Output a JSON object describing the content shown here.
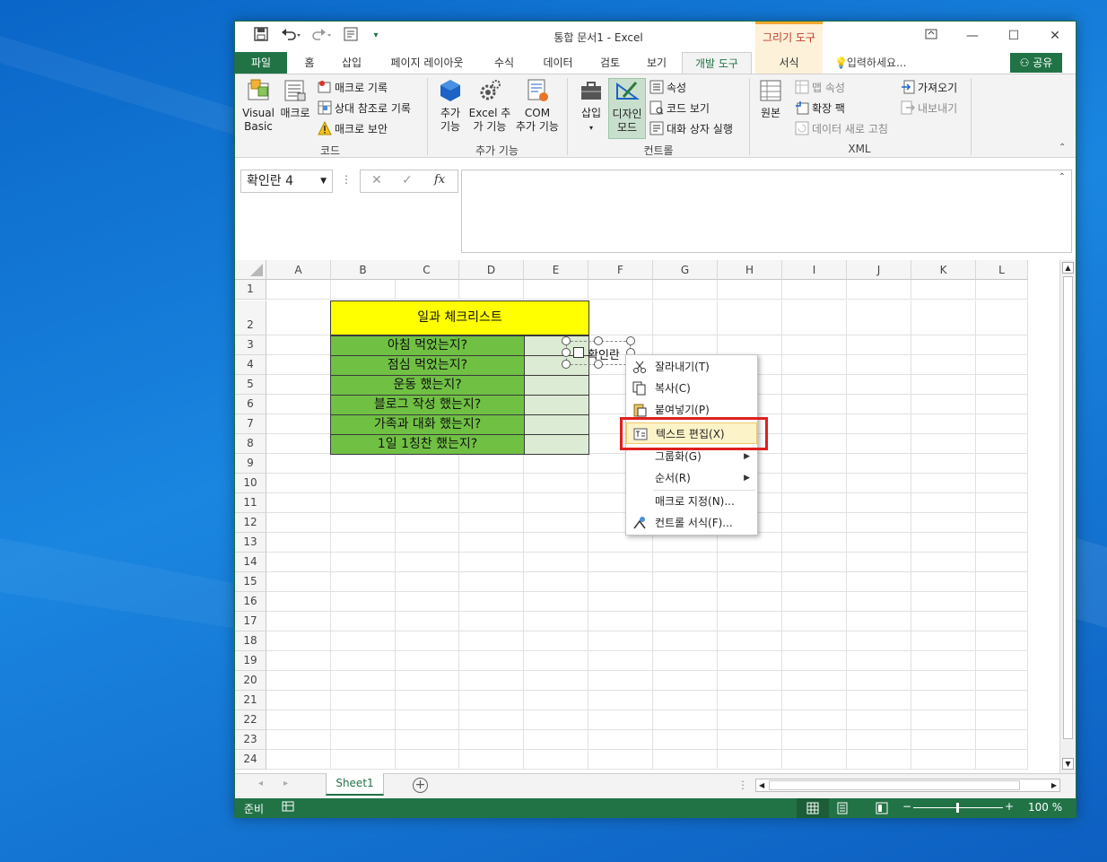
{
  "title": "통합 문서1 - Excel",
  "contextual_tab": "그리기 도구",
  "tabs": [
    "파일",
    "홈",
    "삽입",
    "페이지 레이아웃",
    "수식",
    "데이터",
    "검토",
    "보기",
    "개발 도구",
    "서식"
  ],
  "tell_me": "입력하세요...",
  "share": "공유",
  "ribbon": {
    "code": {
      "label": "코드",
      "visual_basic": "Visual Basic",
      "macro": "매크로",
      "record_macro": "매크로 기록",
      "relative_ref": "상대 참조로 기록",
      "macro_security": "매크로 보안"
    },
    "addins": {
      "label": "추가 기능",
      "addins_1": "추가",
      "addins_2": "기능",
      "excel_addins_1": "Excel 추",
      "excel_addins_2": "가 기능",
      "com_1": "COM",
      "com_2": "추가 기능"
    },
    "controls": {
      "label": "컨트롤",
      "insert": "삽입",
      "design_mode_1": "디자인",
      "design_mode_2": "모드",
      "properties": "속성",
      "view_code": "코드 보기",
      "run_dialog": "대화 상자 실행"
    },
    "xml": {
      "label": "XML",
      "source": "원본",
      "map_properties": "맵 속성",
      "expansion_packs": "확장 팩",
      "refresh_data": "데이터 새로 고침",
      "import": "가져오기",
      "export": "내보내기"
    }
  },
  "namebox": "확인란 4",
  "fx": "fx",
  "columns": [
    "A",
    "B",
    "C",
    "D",
    "E",
    "F",
    "G",
    "H",
    "I",
    "J",
    "K",
    "L"
  ],
  "rows": [
    "1",
    "2",
    "3",
    "4",
    "5",
    "6",
    "7",
    "8",
    "9",
    "10",
    "11",
    "12",
    "13",
    "14",
    "15",
    "16",
    "17",
    "18",
    "19",
    "20",
    "21",
    "22",
    "23",
    "24"
  ],
  "sheet": {
    "title": "일과 체크리스트",
    "tasks": [
      "아침 먹었는지?",
      "점심 먹었는지?",
      "운동 했는지?",
      "블로그 작성 했는지?",
      "가족과 대화 했는지?",
      "1일 1칭찬 했는지?"
    ],
    "checkbox_label": "확인란"
  },
  "context_menu": [
    {
      "label": "잘라내기(T)",
      "icon": "scissors-icon"
    },
    {
      "label": "복사(C)",
      "icon": "copy-icon"
    },
    {
      "label": "붙여넣기(P)",
      "icon": "paste-icon"
    },
    {
      "label": "텍스트 편집(X)",
      "icon": "edit-text-icon"
    },
    {
      "label": "그룹화(G)",
      "icon": ""
    },
    {
      "label": "순서(R)",
      "icon": ""
    },
    {
      "label": "매크로 지정(N)...",
      "icon": ""
    },
    {
      "label": "컨트롤 서식(F)...",
      "icon": "format-control-icon"
    }
  ],
  "sheet_tab": "Sheet1",
  "status": {
    "ready": "준비",
    "zoom": "100 %"
  },
  "colors": {
    "excel_green": "#217346",
    "task_green": "#70c044",
    "title_yellow": "#ffff00",
    "highlight_red": "#e01f1f"
  }
}
